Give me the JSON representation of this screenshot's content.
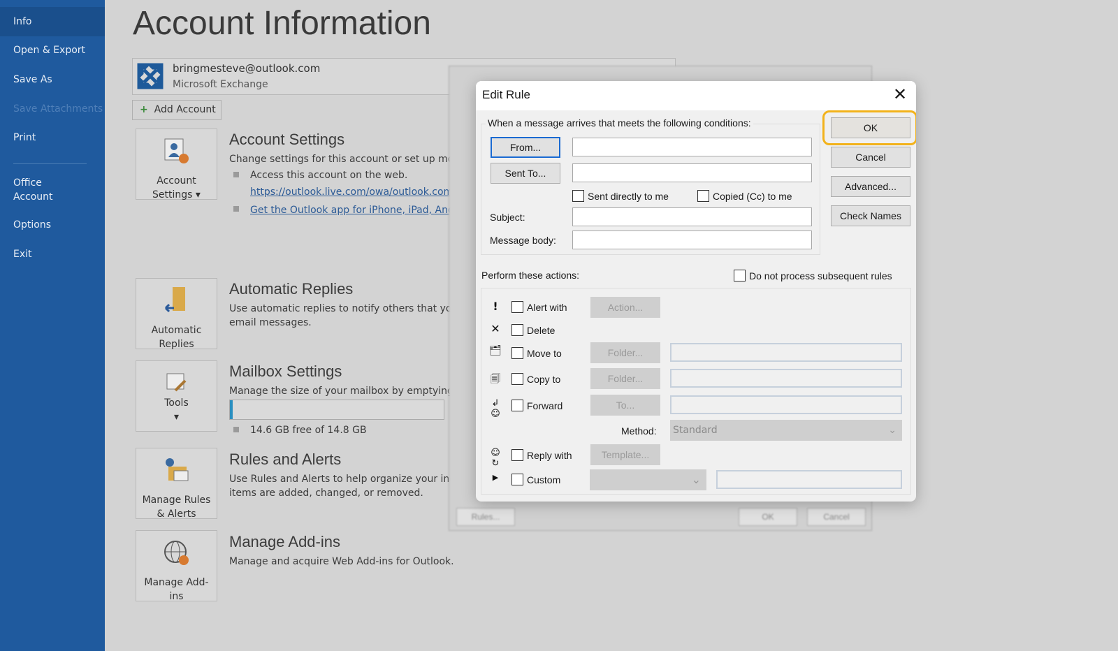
{
  "sidebar": {
    "items": [
      {
        "label": "Info",
        "active": true
      },
      {
        "label": "Open & Export"
      },
      {
        "label": "Save As"
      },
      {
        "label": "Save Attachments",
        "disabled": true
      },
      {
        "label": "Print"
      },
      {
        "label": "Office Account"
      },
      {
        "label": "Options"
      },
      {
        "label": "Exit"
      }
    ]
  },
  "page": {
    "title": "Account Information",
    "account_email": "bringmesteve@outlook.com",
    "account_type": "Microsoft Exchange",
    "add_account": "Add Account"
  },
  "sections": {
    "account_settings": {
      "tile": "Account Settings",
      "title": "Account Settings",
      "desc": "Change settings for this account or set up more",
      "bullet1": "Access this account on the web.",
      "link1": "https://outlook.live.com/owa/outlook.com/",
      "link2": "Get the Outlook app for iPhone, iPad, Andro"
    },
    "auto_replies": {
      "tile": "Automatic Replies",
      "title": "Automatic Replies",
      "desc": "Use automatic replies to notify others that you a",
      "desc2": "email messages."
    },
    "mailbox": {
      "tile": "Tools",
      "title": "Mailbox Settings",
      "desc": "Manage the size of your mailbox by emptying D",
      "usage": "14.6 GB free of 14.8 GB",
      "used_fraction": 0.014
    },
    "rules": {
      "tile": "Manage Rules & Alerts",
      "title": "Rules and Alerts",
      "desc": "Use Rules and Alerts to help organize your incor",
      "desc2": "items are added, changed, or removed."
    },
    "addins": {
      "tile": "Manage Add-ins",
      "title": "Manage Add-ins",
      "desc": "Manage and acquire Web Add-ins for Outlook."
    }
  },
  "bg_dialog": {
    "rules": "Rules...",
    "ok": "OK",
    "cancel": "Cancel"
  },
  "dialog": {
    "title": "Edit Rule",
    "conditions_label": "When a message arrives that meets the following conditions:",
    "from": "From...",
    "sent_to": "Sent To...",
    "sent_directly": "Sent directly to me",
    "copied": "Copied (Cc) to me",
    "subject": "Subject:",
    "message_body": "Message body:",
    "ok": "OK",
    "cancel": "Cancel",
    "advanced": "Advanced...",
    "check_names": "Check Names",
    "actions_label": "Perform these actions:",
    "do_not_process": "Do not process subsequent rules",
    "actions": {
      "alert": "Alert with",
      "alert_btn": "Action...",
      "delete": "Delete",
      "move": "Move to",
      "move_btn": "Folder...",
      "copy": "Copy to",
      "copy_btn": "Folder...",
      "forward": "Forward",
      "forward_btn": "To...",
      "method": "Method:",
      "method_value": "Standard",
      "reply": "Reply with",
      "reply_btn": "Template...",
      "custom": "Custom"
    },
    "highlight_color": "#f2b21b"
  }
}
